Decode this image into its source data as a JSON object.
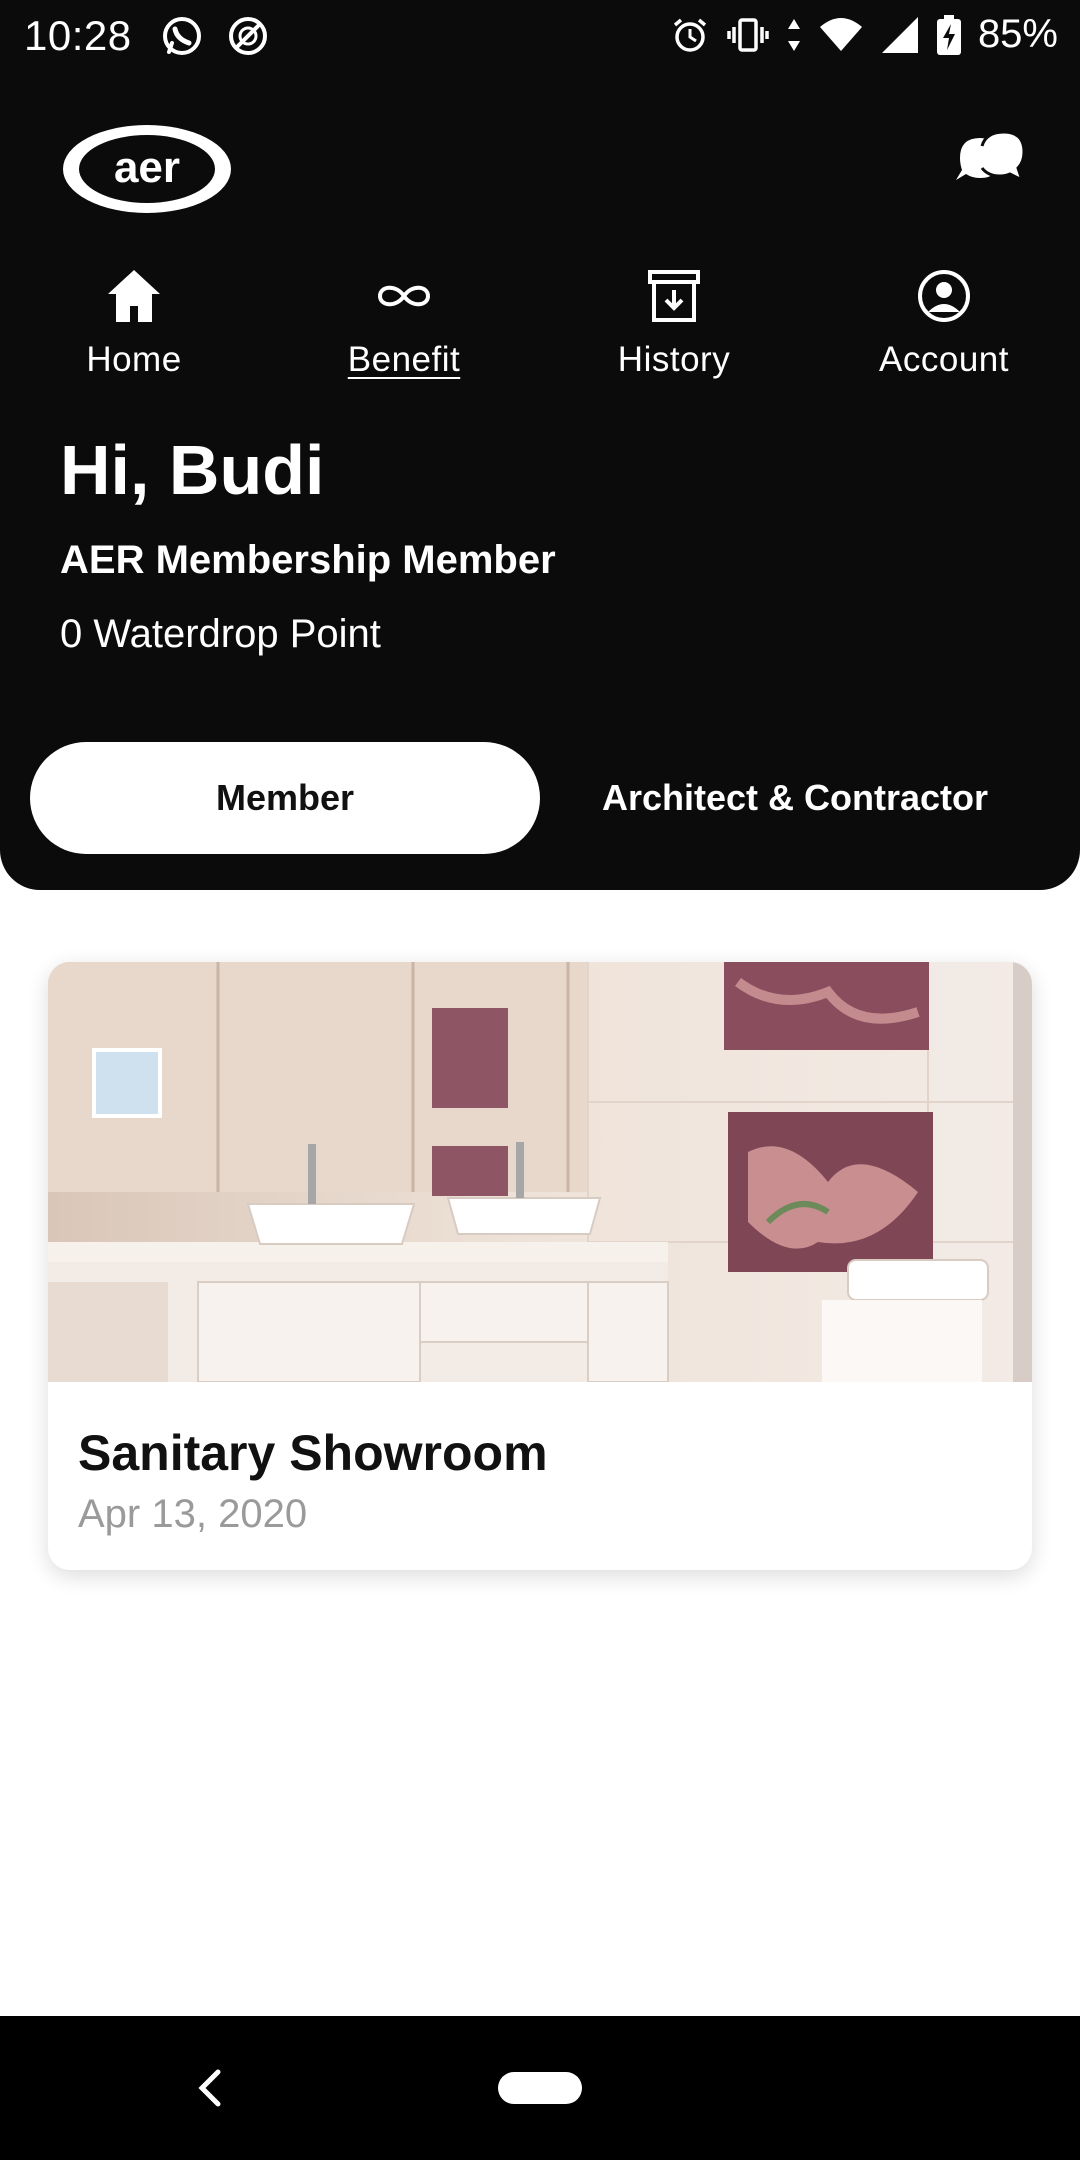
{
  "status_bar": {
    "time": "10:28",
    "battery": "85%",
    "left_icons": [
      "whatsapp-icon",
      "no-disturb-icon"
    ],
    "right_icons": [
      "alarm-icon",
      "vibrate-icon",
      "data-icon",
      "wifi-icon",
      "signal-icon",
      "battery-charging-icon"
    ]
  },
  "app": {
    "logo_text": "aer",
    "chat_icon": "chat-bubbles-icon"
  },
  "nav": {
    "items": [
      {
        "label": "Home",
        "icon": "home-icon"
      },
      {
        "label": "Benefit",
        "icon": "infinity-icon",
        "active": true
      },
      {
        "label": "History",
        "icon": "archive-download-icon"
      },
      {
        "label": "Account",
        "icon": "account-circle-icon"
      }
    ]
  },
  "profile": {
    "greeting": "Hi, Budi",
    "membership": "AER Membership Member",
    "points": "0 Waterdrop Point"
  },
  "tabs": {
    "member": "Member",
    "architect": "Architect & Contractor",
    "selected": "Member"
  },
  "cards": [
    {
      "title": "Sanitary Showroom",
      "date": "Apr 13, 2020",
      "image": "bathroom-showroom-photo"
    }
  ],
  "colors": {
    "header_bg": "#0b0b0c",
    "text_light": "#ffffff",
    "date_gray": "#9a9a9a",
    "accent_tile": "#8a4d5d"
  }
}
